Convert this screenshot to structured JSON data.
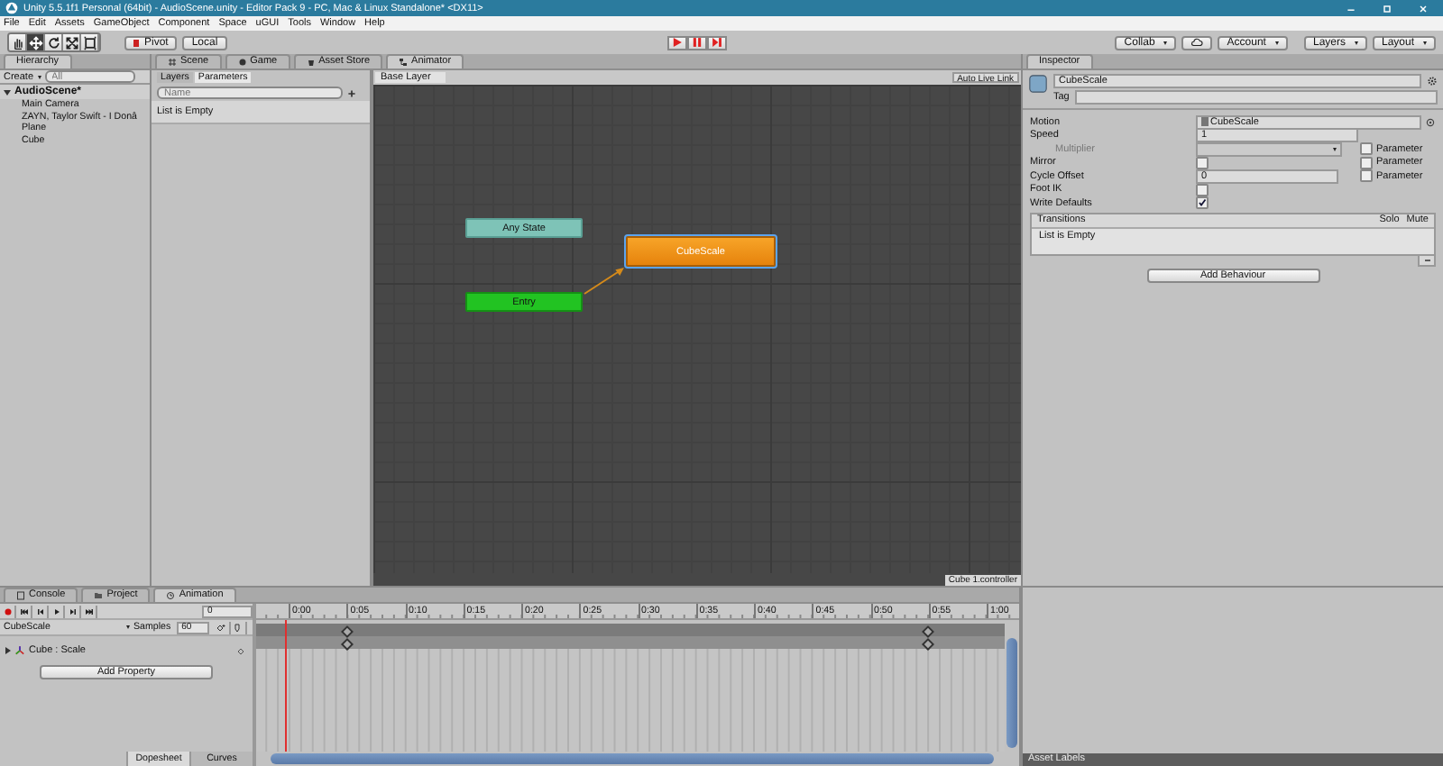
{
  "window": {
    "title": "Unity 5.5.1f1 Personal (64bit) - AudioScene.unity - Editor Pack 9 - PC, Mac & Linux Standalone* <DX11>"
  },
  "menu": [
    "File",
    "Edit",
    "Assets",
    "GameObject",
    "Component",
    "Space",
    "uGUI",
    "Tools",
    "Window",
    "Help"
  ],
  "toolbar": {
    "tools": [
      {
        "kind": "hand",
        "selected": false
      },
      {
        "kind": "move",
        "selected": true
      },
      {
        "kind": "rotate",
        "selected": false
      },
      {
        "kind": "scale",
        "selected": false
      },
      {
        "kind": "rect",
        "selected": false
      }
    ],
    "pivot": "Pivot",
    "space": "Local",
    "play_controls": [
      {
        "kind": "play"
      },
      {
        "kind": "pause"
      },
      {
        "kind": "step"
      }
    ],
    "collab": "Collab",
    "account": "Account",
    "layers": "Layers",
    "layout": "Layout"
  },
  "hierarchy": {
    "tab": "Hierarchy",
    "create": "Create",
    "search_placeholder": "All",
    "scene": {
      "name": "AudioScene*",
      "expanded": true,
      "children": [
        {
          "name": "Main Camera"
        },
        {
          "name": "ZAYN, Taylor Swift - I Donâ"
        },
        {
          "name": "Plane"
        },
        {
          "name": "Cube"
        }
      ]
    }
  },
  "center_tabs": [
    {
      "label": "Scene",
      "kind": "scene",
      "selected": false
    },
    {
      "label": "Game",
      "kind": "game",
      "selected": false
    },
    {
      "label": "Asset Store",
      "kind": "store",
      "selected": false
    },
    {
      "label": "Animator",
      "kind": "animator",
      "selected": true
    }
  ],
  "animator": {
    "side_tabs": [
      {
        "label": "Layers",
        "selected": false
      },
      {
        "label": "Parameters",
        "selected": true
      }
    ],
    "search_placeholder": "Name",
    "empty_text": "List is Empty",
    "breadcrumb": "Base Layer",
    "live_link": "Auto Live Link",
    "nodes": [
      {
        "label": "Any State",
        "kind": "any",
        "selected": false
      },
      {
        "label": "CubeScale",
        "kind": "default",
        "selected": true
      },
      {
        "label": "Entry",
        "kind": "entry",
        "selected": false
      }
    ],
    "footer": "Cube 1.controller"
  },
  "inspector": {
    "tab": "Inspector",
    "name": "CubeScale",
    "tag_label": "Tag",
    "fields": [
      {
        "label": "Motion",
        "kind": "object",
        "value": "CubeScale",
        "disabled": false
      },
      {
        "label": "Speed",
        "kind": "text",
        "value": "1",
        "disabled": false
      },
      {
        "label": "Multiplier",
        "kind": "dropdown",
        "disabled": true,
        "parameter": {
          "label": "Parameter",
          "checked": false
        }
      },
      {
        "label": "Mirror",
        "kind": "checkbox",
        "checked": false,
        "disabled": false,
        "parameter": {
          "label": "Parameter",
          "checked": false
        }
      },
      {
        "label": "Cycle Offset",
        "kind": "text",
        "value": "0",
        "disabled": false,
        "parameter": {
          "label": "Parameter",
          "checked": false
        }
      },
      {
        "label": "Foot IK",
        "kind": "checkbox",
        "checked": false,
        "disabled": false
      },
      {
        "label": "Write Defaults",
        "kind": "checkbox",
        "checked": true,
        "disabled": false
      }
    ],
    "transitions": {
      "title": "Transitions",
      "solo": "Solo",
      "mute": "Mute",
      "empty_text": "List is Empty"
    },
    "add_button": "Add Behaviour"
  },
  "bottom_tabs": [
    {
      "label": "Console",
      "kind": "console",
      "selected": false
    },
    {
      "label": "Project",
      "kind": "project",
      "selected": false
    },
    {
      "label": "Animation",
      "kind": "animation",
      "selected": true
    }
  ],
  "animation": {
    "frame": "0",
    "clip": "CubeScale",
    "samples_label": "Samples",
    "samples": "60",
    "property": "Cube : Scale",
    "add_property": "Add Property",
    "ticks": [
      {
        "label": "0:00",
        "keyframe": false
      },
      {
        "label": "0:05",
        "keyframe": true
      },
      {
        "label": "0:10",
        "keyframe": false
      },
      {
        "label": "0:15",
        "keyframe": false
      },
      {
        "label": "0:20",
        "keyframe": false
      },
      {
        "label": "0:25",
        "keyframe": false
      },
      {
        "label": "0:30",
        "keyframe": false
      },
      {
        "label": "0:35",
        "keyframe": false
      },
      {
        "label": "0:40",
        "keyframe": false
      },
      {
        "label": "0:45",
        "keyframe": false
      },
      {
        "label": "0:50",
        "keyframe": false
      },
      {
        "label": "0:55",
        "keyframe": true
      },
      {
        "label": "1:00",
        "keyframe": false
      }
    ],
    "view_tabs": [
      {
        "label": "Dopesheet",
        "selected": true
      },
      {
        "label": "Curves",
        "selected": false
      }
    ]
  },
  "asset_labels": "Asset Labels"
}
